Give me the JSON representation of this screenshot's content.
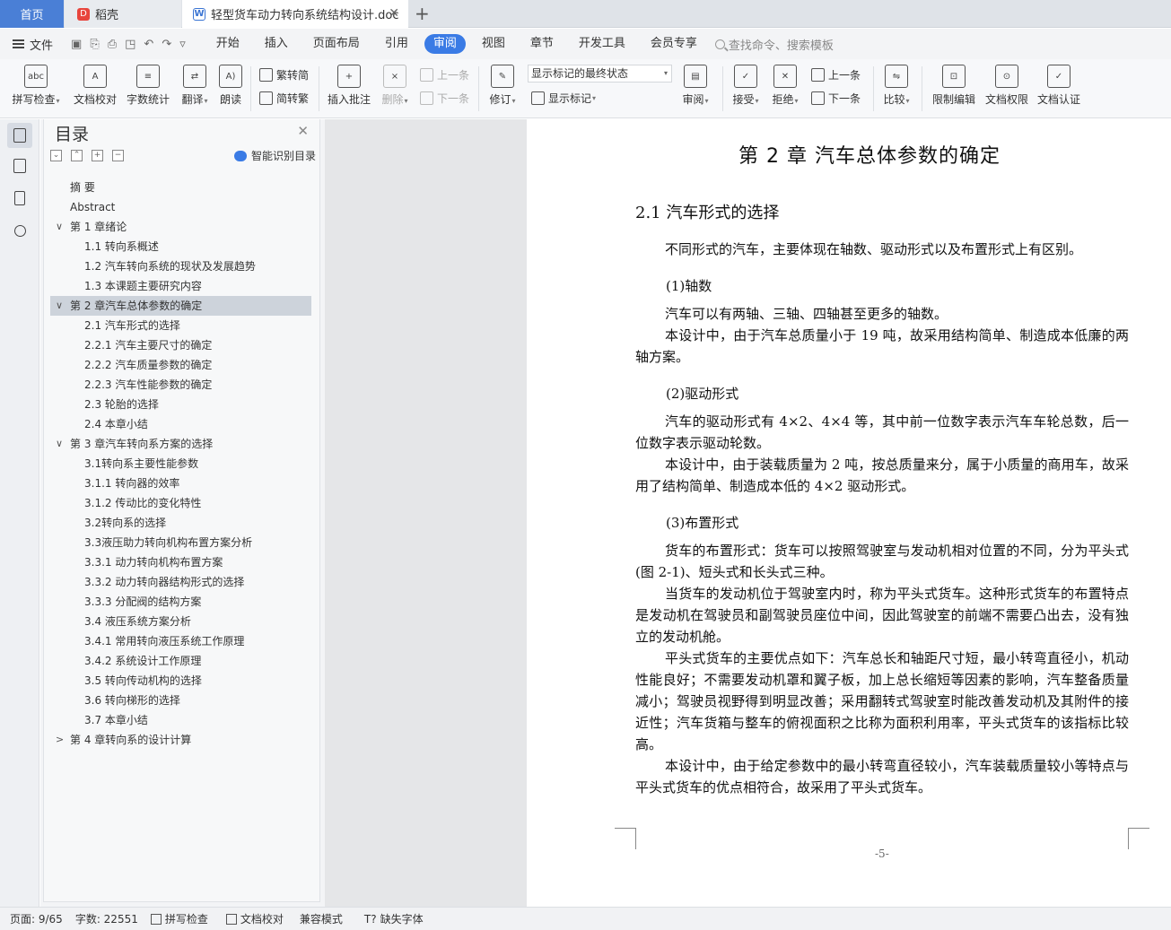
{
  "tabs": {
    "home": "首页",
    "daoke": "稻壳",
    "doc": "轻型货车动力转向系统结构设计.doc",
    "add": "+",
    "close": "✕"
  },
  "menu": {
    "file": "文件",
    "items": [
      "开始",
      "插入",
      "页面布局",
      "引用",
      "审阅",
      "视图",
      "章节",
      "开发工具",
      "会员专享"
    ],
    "active": "审阅",
    "search": "查找命令、搜索模板"
  },
  "ribbon": {
    "spell": "拼写检查",
    "proof": "文档校对",
    "wordcount": "字数统计",
    "translate": "翻译",
    "read": "朗读",
    "trad": "繁转简",
    "simp": "简转繁",
    "insert_comment": "插入批注",
    "delete": "删除",
    "prev1": "上一条",
    "next1": "下一条",
    "track": "修订",
    "display_mode": "显示标记的最终状态",
    "show_marks": "显示标记",
    "review": "审阅",
    "accept": "接受",
    "reject": "拒绝",
    "prev2": "上一条",
    "next2": "下一条",
    "compare": "比较",
    "restrict": "限制编辑",
    "rights": "文档权限",
    "certify": "文档认证"
  },
  "toc": {
    "title": "目录",
    "smart": "智能识别目录",
    "items": [
      {
        "text": "摘  要",
        "level": 0
      },
      {
        "text": "Abstract",
        "level": 0
      },
      {
        "text": "第  1  章绪论",
        "level": 1,
        "chev": "∨"
      },
      {
        "text": "1.1 转向系概述",
        "level": 2
      },
      {
        "text": "1.2 汽车转向系统的现状及发展趋势",
        "level": 2
      },
      {
        "text": "1.3  本课题主要研究内容",
        "level": 2
      },
      {
        "text": "第  2  章汽车总体参数的确定",
        "level": 1,
        "chev": "∨",
        "selected": true
      },
      {
        "text": "2.1 汽车形式的选择",
        "level": 2
      },
      {
        "text": "2.2.1 汽车主要尺寸的确定",
        "level": 2
      },
      {
        "text": "2.2.2 汽车质量参数的确定",
        "level": 2
      },
      {
        "text": "2.2.3 汽车性能参数的确定",
        "level": 2
      },
      {
        "text": "2.3 轮胎的选择",
        "level": 2
      },
      {
        "text": "2.4 本章小结",
        "level": 2
      },
      {
        "text": "第  3  章汽车转向系方案的选择",
        "level": 1,
        "chev": "∨"
      },
      {
        "text": "3.1转向系主要性能参数",
        "level": 2
      },
      {
        "text": "3.1.1 转向器的效率",
        "level": 2
      },
      {
        "text": "3.1.2 传动比的变化特性",
        "level": 2
      },
      {
        "text": "3.2转向系的选择",
        "level": 2
      },
      {
        "text": "3.3液压助力转向机构布置方案分析",
        "level": 2
      },
      {
        "text": "3.3.1 动力转向机构布置方案",
        "level": 2
      },
      {
        "text": "3.3.2 动力转向器结构形式的选择",
        "level": 2
      },
      {
        "text": "3.3.3 分配阀的结构方案",
        "level": 2
      },
      {
        "text": "3.4 液压系统方案分析",
        "level": 2
      },
      {
        "text": "3.4.1 常用转向液压系统工作原理",
        "level": 2
      },
      {
        "text": "3.4.2 系统设计工作原理",
        "level": 2
      },
      {
        "text": "3.5 转向传动机构的选择",
        "level": 2
      },
      {
        "text": "3.6 转向梯形的选择",
        "level": 2
      },
      {
        "text": "3.7 本章小结",
        "level": 2
      },
      {
        "text": "第  4  章转向系的设计计算",
        "level": 1,
        "chev": ">"
      }
    ]
  },
  "doc": {
    "chapter_title": "第 2 章 汽车总体参数的确定",
    "section_title": "2.1 汽车形式的选择",
    "p_intro": "不同形式的汽车，主要体现在轴数、驱动形式以及布置形式上有区别。",
    "sub1": "(1)轴数",
    "p_axle1": "汽车可以有两轴、三轴、四轴甚至更多的轴数。",
    "p_axle2": "本设计中，由于汽车总质量小于 19 吨，故采用结构简单、制造成本低廉的两轴方案。",
    "sub2": "(2)驱动形式",
    "p_drive1": "汽车的驱动形式有 4×2、4×4 等，其中前一位数字表示汽车车轮总数，后一位数字表示驱动轮数。",
    "p_drive2": "  本设计中，由于装载质量为 2 吨，按总质量来分，属于小质量的商用车，故采用了结构简单、制造成本低的 4×2 驱动形式。",
    "sub3": "(3)布置形式",
    "p_layout1": "货车的布置形式：货车可以按照驾驶室与发动机相对位置的不同，分为平头式(图 2-1)、短头式和长头式三种。",
    "p_layout2": "当货车的发动机位于驾驶室内时，称为平头式货车。这种形式货车的布置特点是发动机在驾驶员和副驾驶员座位中间，因此驾驶室的前端不需要凸出去，没有独立的发动机舱。",
    "p_layout3": "平头式货车的主要优点如下：汽车总长和轴距尺寸短，最小转弯直径小，机动性能良好；不需要发动机罩和翼子板，加上总长缩短等因素的影响，汽车整备质量减小；驾驶员视野得到明显改善；采用翻转式驾驶室时能改善发动机及其附件的接近性；汽车货箱与整车的俯视面积之比称为面积利用率，平头式货车的该指标比较高。",
    "p_layout4": "本设计中，由于给定参数中的最小转弯直径较小，汽车装载质量较小等特点与平头式货车的优点相符合，故采用了平头式货车。",
    "page_number": "-5-"
  },
  "status": {
    "page": "页面: 9/65",
    "words": "字数: 22551",
    "spell": "拼写检查",
    "proof": "文档校对",
    "compat": "兼容模式",
    "missing_font": "缺失字体"
  }
}
